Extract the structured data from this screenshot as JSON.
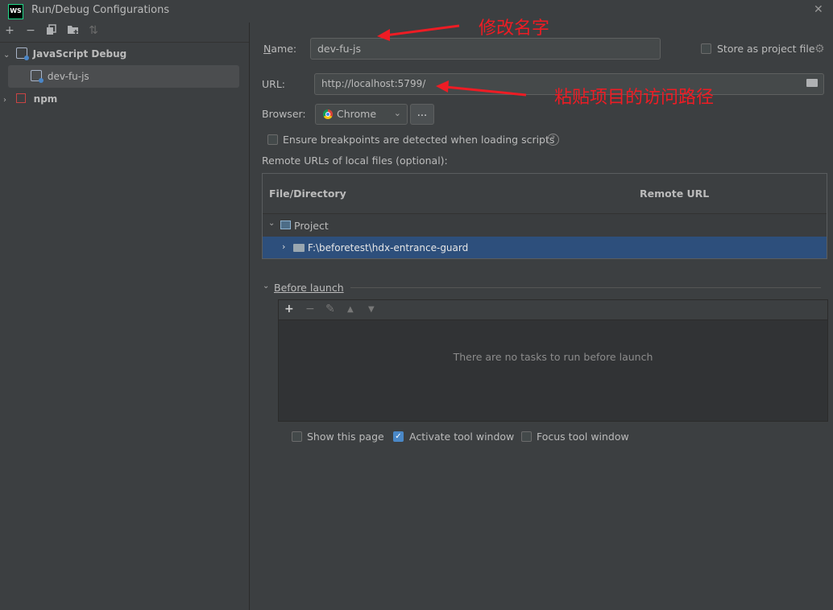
{
  "window": {
    "title": "Run/Debug Configurations",
    "app_badge": "WS"
  },
  "left": {
    "toolbar": [
      "add-icon",
      "remove-icon",
      "copy-icon",
      "folder-add-icon",
      "sort-icon"
    ],
    "tree": [
      {
        "label": "JavaScript Debug",
        "expanded": true
      },
      {
        "label": "dev-fu-js",
        "selected": true
      },
      {
        "label": "npm",
        "expanded": false
      }
    ]
  },
  "form": {
    "name_label": "Name:",
    "name_value": "dev-fu-js",
    "store_label": "Store as project file",
    "url_label": "URL:",
    "url_value": "http://localhost:5799/",
    "browser_label": "Browser:",
    "browser_value": "Chrome",
    "browser_more": "...",
    "ensure_label": "Ensure breakpoints are detected when loading scripts",
    "remote_label": "Remote URLs of local files (optional):"
  },
  "table": {
    "col1": "File/Directory",
    "col2": "Remote URL",
    "project": "Project",
    "dir": "F:\\beforetest\\hdx-entrance-guard"
  },
  "before_launch": {
    "title": "Before launch",
    "empty": "There are no tasks to run before launch"
  },
  "options": {
    "show_page": "Show this page",
    "activate": "Activate tool window",
    "focus": "Focus tool window"
  },
  "annotations": {
    "rename": "修改名字",
    "paste_url": "粘贴项目的访问路径",
    "color": "#ee1c24"
  }
}
